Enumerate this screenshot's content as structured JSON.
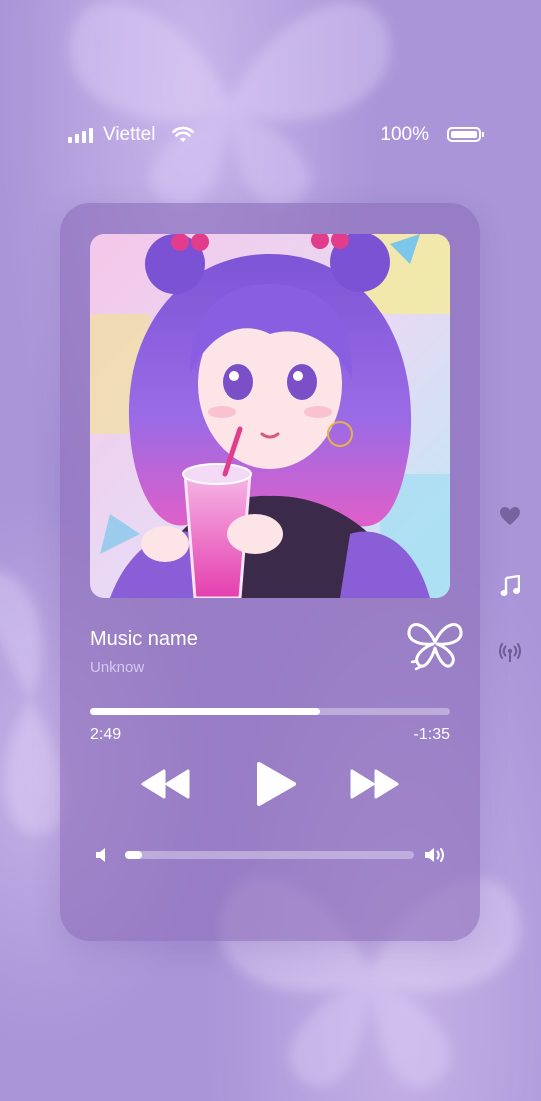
{
  "status_bar": {
    "carrier": "Viettel",
    "battery_percent": "100%",
    "icons": [
      "signal-bars-icon",
      "wifi-icon",
      "battery-icon"
    ]
  },
  "player": {
    "track_title": "Music name",
    "artist": "Unknow",
    "time_elapsed": "2:49",
    "time_remaining": "-1:35",
    "progress_fraction": 0.64,
    "volume_fraction": 0.06,
    "controls": [
      "rewind-icon",
      "play-icon",
      "fast-forward-icon"
    ],
    "volume_icons": [
      "volume-low-icon",
      "volume-high-icon"
    ],
    "artwork": "anime girl with purple hair drinking pink beverage"
  },
  "side_icons": [
    "heart-icon",
    "music-note-icon",
    "broadcast-icon"
  ],
  "colors": {
    "background": "#a995d8",
    "card": "#8c6eb9",
    "accent": "#ffffff",
    "secondary_text": "#d7c8f0"
  }
}
